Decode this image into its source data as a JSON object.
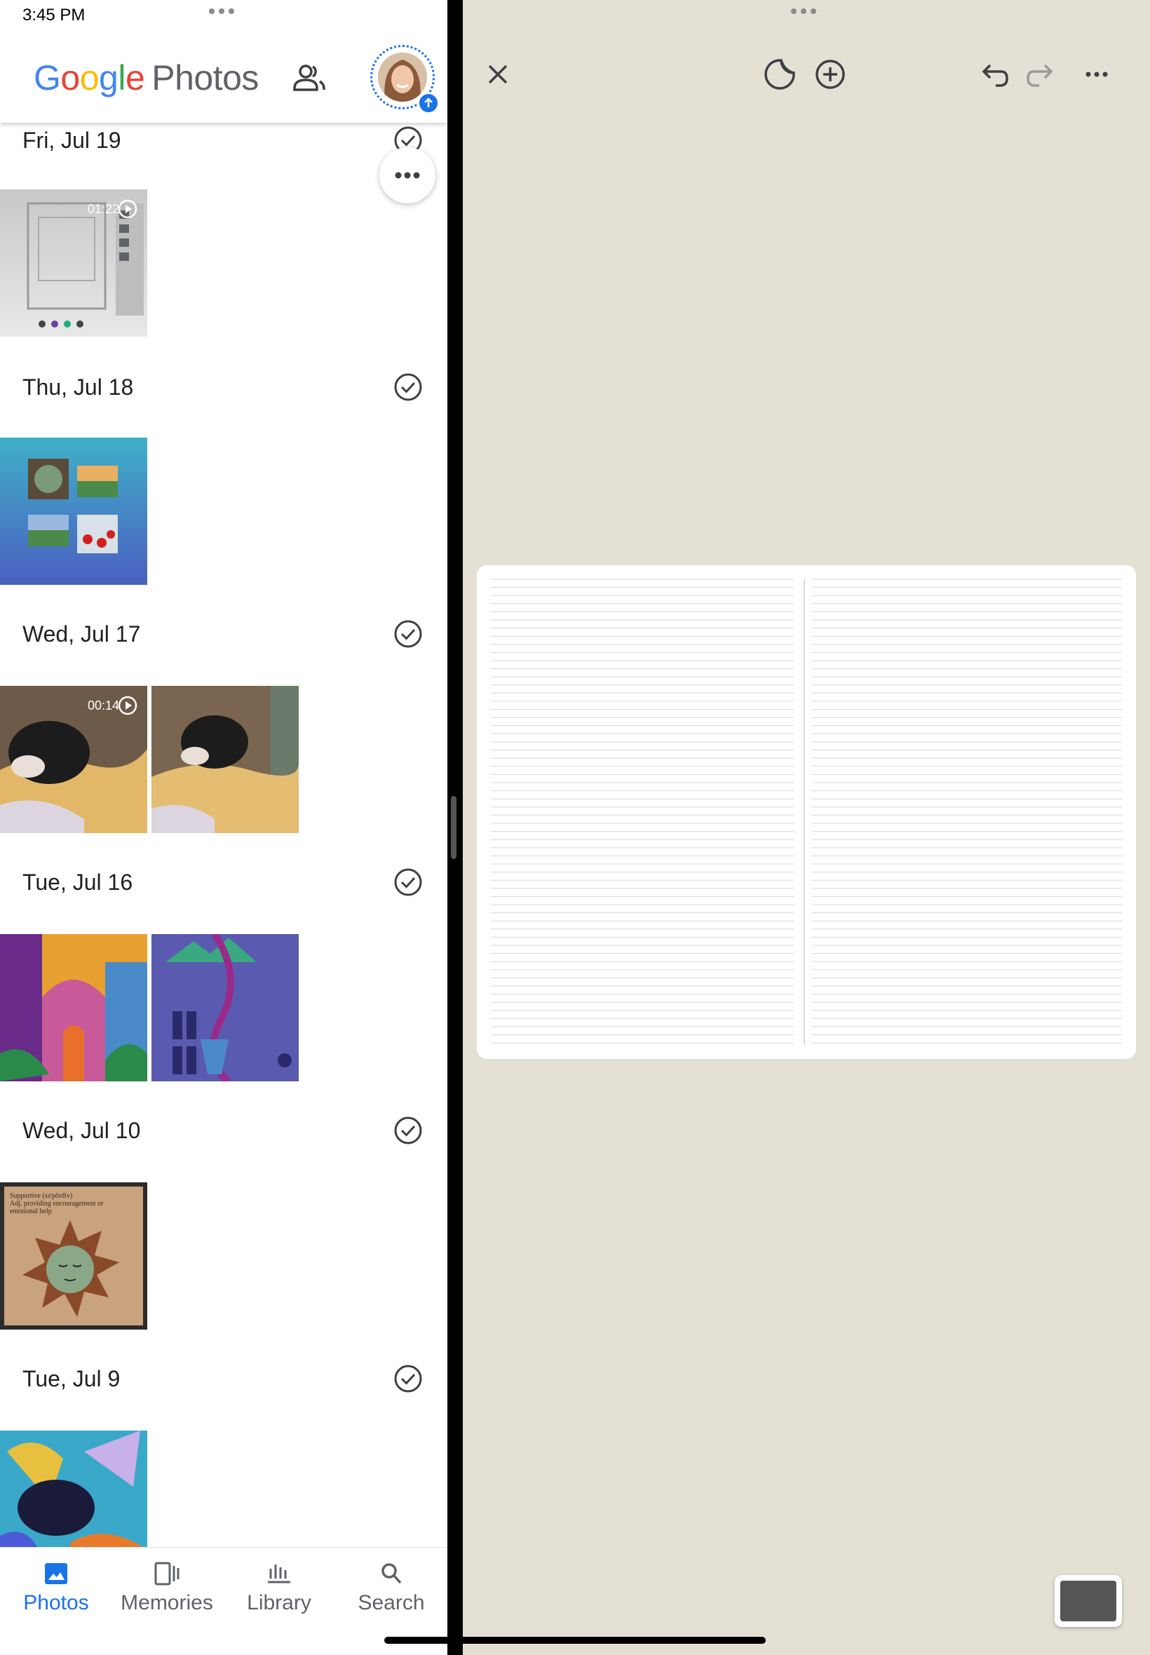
{
  "status_bar": {
    "time": "3:45 PM"
  },
  "photos_app": {
    "logo": {
      "google": "Google",
      "product": "Photos"
    },
    "sections": [
      {
        "date": "Fri, Jul 19",
        "items": [
          {
            "type": "video",
            "duration": "01:22"
          }
        ]
      },
      {
        "date": "Thu, Jul 18",
        "items": [
          {
            "type": "photo"
          }
        ]
      },
      {
        "date": "Wed, Jul 17",
        "items": [
          {
            "type": "video",
            "duration": "00:14"
          },
          {
            "type": "photo"
          }
        ]
      },
      {
        "date": "Tue, Jul 16",
        "items": [
          {
            "type": "photo"
          },
          {
            "type": "photo"
          }
        ]
      },
      {
        "date": "Wed, Jul 10",
        "items": [
          {
            "type": "photo",
            "caption_lines": [
              "Supportive (sə'pôrdiv)",
              "Adj. providing encouragement or",
              "emotional help"
            ]
          }
        ]
      },
      {
        "date": "Tue, Jul 9",
        "items": [
          {
            "type": "photo"
          }
        ]
      }
    ],
    "bottom_nav": [
      {
        "label": "Photos",
        "icon": "photo-icon",
        "active": true
      },
      {
        "label": "Memories",
        "icon": "memories-icon",
        "active": false
      },
      {
        "label": "Library",
        "icon": "library-icon",
        "active": false
      },
      {
        "label": "Search",
        "icon": "search-icon",
        "active": false
      }
    ],
    "colors": {
      "accent": "#1a73e8"
    }
  },
  "notes_app": {
    "toolbar": [
      "close-icon",
      "sticker-icon",
      "add-icon",
      "undo-icon",
      "redo-icon",
      "more-icon"
    ],
    "background": "#e4e0d4"
  }
}
